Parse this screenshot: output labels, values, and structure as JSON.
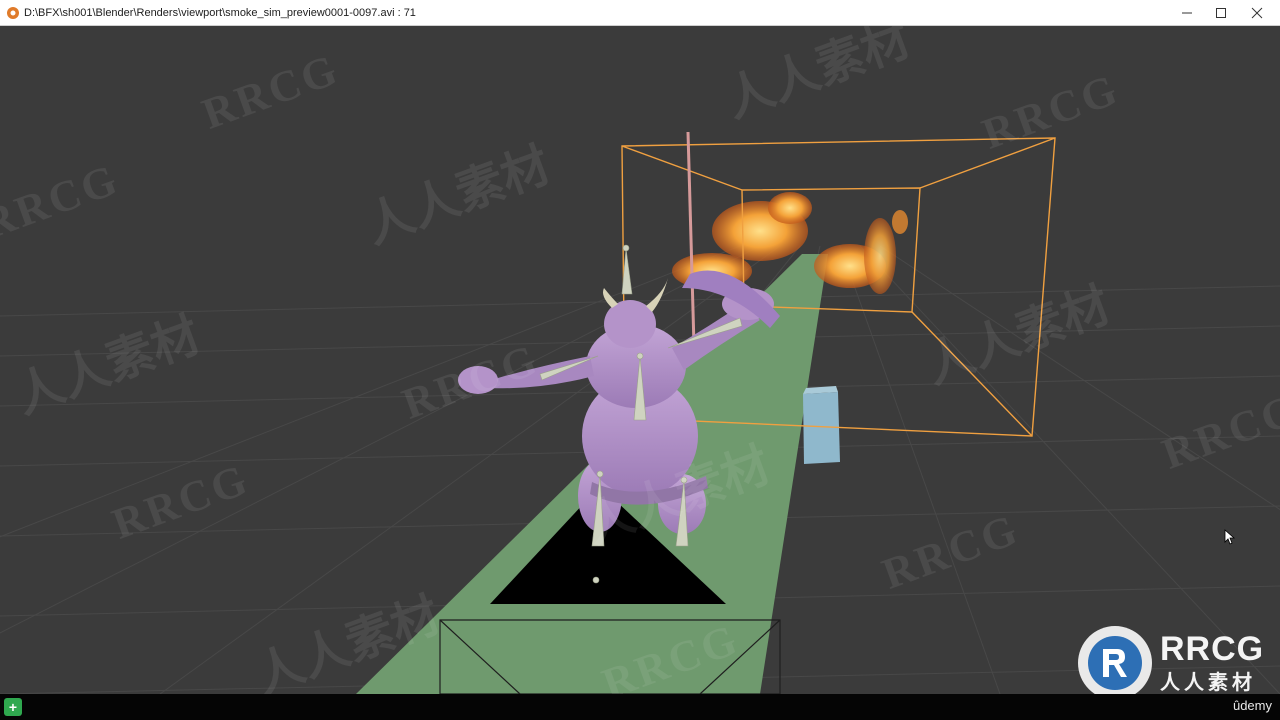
{
  "window": {
    "title": "D:\\BFX\\sh001\\Blender\\Renders\\viewport\\smoke_sim_preview0001-0097.avi :   71",
    "controls": [
      "minimize",
      "maximize",
      "close"
    ]
  },
  "watermarks": {
    "cjk": "人人素材",
    "latin": "RRCG"
  },
  "logo": {
    "title": "RRCG",
    "subtitle": "人人素材"
  },
  "statusbar": {
    "brand": "ûdemy"
  },
  "colors": {
    "viewport_bg": "#3b3b3b",
    "grid_line": "#4a4a4a",
    "ground_strip": "#6f9a6e",
    "domain_box": "#f0a040",
    "character": "#b493c9",
    "fire": "#f09a30",
    "cube": "#8fb8cc"
  }
}
